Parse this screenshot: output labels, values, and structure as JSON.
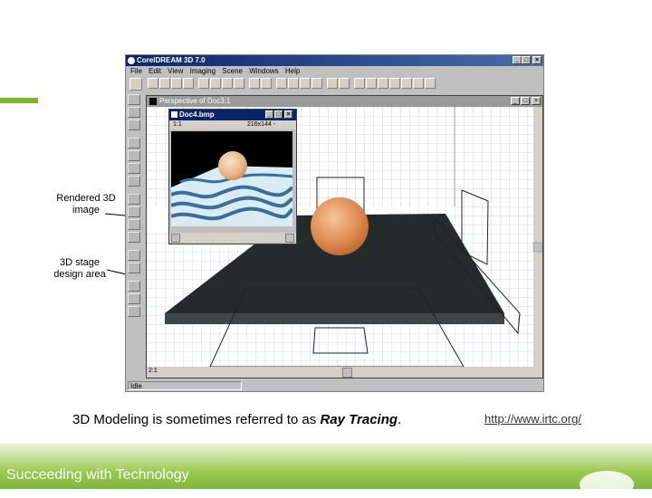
{
  "app": {
    "title": "CorelDREAM 3D 7.0",
    "menu": [
      "File",
      "Edit",
      "View",
      "Imaging",
      "Scene",
      "Windows",
      "Help"
    ],
    "status": "Idle",
    "perspective_window": {
      "title": "Perspective of Doc3:1",
      "zoom": "2:1"
    },
    "doc_window": {
      "title": "Doc4.bmp",
      "zoom": "1:1",
      "size": "216x144 -"
    }
  },
  "annotations": {
    "rendered": "Rendered 3D image",
    "stage": "3D stage design area"
  },
  "caption": {
    "prefix": "3D Modeling is sometimes referred to as ",
    "emphasis": "Ray Tracing",
    "suffix": "."
  },
  "link": "http://www.irtc.org/",
  "footer": "Succeeding with Technology",
  "colors": {
    "accent": "#7db52a",
    "titlebar": "#0a246a",
    "sphere": "#e8955c",
    "stage": "#252a2a",
    "grid": "#9fd0d4"
  }
}
